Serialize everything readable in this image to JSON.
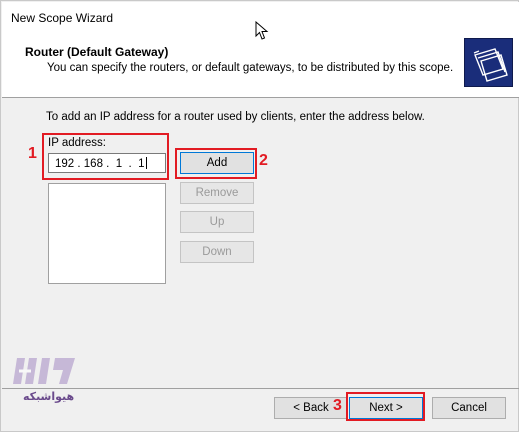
{
  "window": {
    "title": "New Scope Wizard"
  },
  "header": {
    "heading": "Router (Default Gateway)",
    "subheading": "You can specify the routers, or default gateways, to be distributed by this scope.",
    "icon": "folders-icon"
  },
  "main": {
    "instruction": "To add an IP address for a router used by clients, enter the address below.",
    "ip_label": "IP address:",
    "ip_value": "192 . 168 .  1  .  1",
    "buttons": {
      "add": "Add",
      "remove": "Remove",
      "up": "Up",
      "down": "Down"
    }
  },
  "footer": {
    "back": "< Back",
    "next": "Next >",
    "cancel": "Cancel"
  },
  "annotations": {
    "color": "#e21b23",
    "markers": [
      "1",
      "2",
      "3"
    ]
  },
  "watermark": {
    "text": "هیواشبکه",
    "color": "#6a4a8c"
  }
}
